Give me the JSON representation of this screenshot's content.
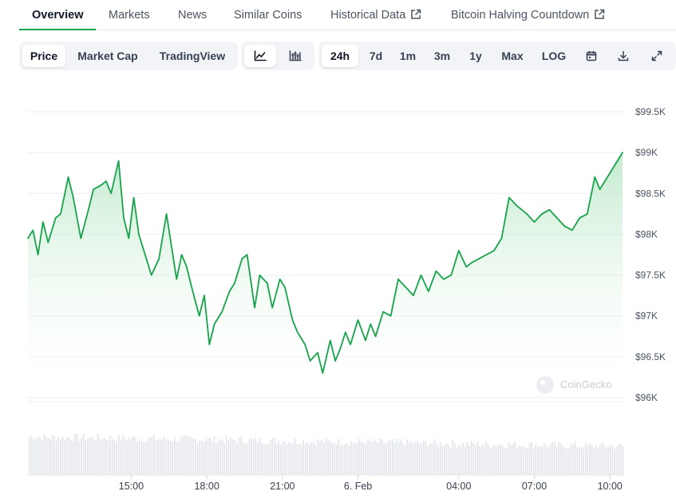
{
  "tabs": [
    {
      "label": "Overview",
      "active": true
    },
    {
      "label": "Markets"
    },
    {
      "label": "News"
    },
    {
      "label": "Similar Coins"
    },
    {
      "label": "Historical Data",
      "external": true
    },
    {
      "label": "Bitcoin Halving Countdown",
      "external": true
    }
  ],
  "toolbar": {
    "metric_buttons": [
      {
        "label": "Price",
        "active": true
      },
      {
        "label": "Market Cap"
      },
      {
        "label": "TradingView"
      }
    ],
    "chart_type_icons": [
      "line-chart-icon",
      "candlestick-icon"
    ],
    "ranges": [
      {
        "label": "24h",
        "active": true
      },
      {
        "label": "7d"
      },
      {
        "label": "1m"
      },
      {
        "label": "3m"
      },
      {
        "label": "1y"
      },
      {
        "label": "Max"
      },
      {
        "label": "LOG"
      }
    ],
    "tool_icons": [
      "calendar-icon",
      "download-icon",
      "fullscreen-icon"
    ]
  },
  "watermark": "CoinGecko",
  "colors": {
    "line": "#16a34a",
    "fill_top": "#bfe9cb",
    "volume": "#e4e7eb",
    "tab_underline": "#16a34a"
  },
  "chart_data": {
    "type": "area",
    "currency": "USD",
    "y_ticks": [
      {
        "value": 99500,
        "label": "$99.5K"
      },
      {
        "value": 99000,
        "label": "$99K"
      },
      {
        "value": 98500,
        "label": "$98.5K"
      },
      {
        "value": 98000,
        "label": "$98K"
      },
      {
        "value": 97500,
        "label": "$97.5K"
      },
      {
        "value": 97000,
        "label": "$97K"
      },
      {
        "value": 96500,
        "label": "$96.5K"
      },
      {
        "value": 96000,
        "label": "$96K"
      }
    ],
    "ylim": [
      96000,
      99500
    ],
    "x_ticks": [
      {
        "value": 15,
        "label": "15:00"
      },
      {
        "value": 18,
        "label": "18:00"
      },
      {
        "value": 21,
        "label": "21:00"
      },
      {
        "value": 24,
        "label": "6. Feb"
      },
      {
        "value": 28,
        "label": "04:00"
      },
      {
        "value": 31,
        "label": "07:00"
      },
      {
        "value": 34,
        "label": "10:00"
      }
    ],
    "xlim": [
      10.9,
      34.5
    ],
    "grid": true,
    "series": [
      {
        "x": [
          10.9,
          11.1,
          11.3,
          11.5,
          11.7,
          12.0,
          12.2,
          12.5,
          12.7,
          13.0,
          13.3,
          13.5,
          13.8,
          14.0,
          14.2,
          14.5,
          14.7,
          14.9,
          15.1,
          15.3,
          15.5,
          15.8,
          16.1,
          16.4,
          16.6,
          16.8,
          17.0,
          17.2,
          17.4,
          17.7,
          17.9,
          18.1,
          18.3,
          18.6,
          18.9,
          19.1,
          19.4,
          19.6,
          19.9,
          20.1,
          20.4,
          20.6,
          20.9,
          21.1,
          21.4,
          21.6,
          21.9,
          22.1,
          22.4,
          22.6,
          22.9,
          23.1,
          23.3,
          23.5,
          23.7,
          24.0,
          24.3,
          24.5,
          24.7,
          25.0,
          25.3,
          25.6,
          25.9,
          26.2,
          26.5,
          26.8,
          27.1,
          27.4,
          27.7,
          28.0,
          28.3,
          28.5,
          28.8,
          29.1,
          29.4,
          29.7,
          30.0,
          30.3,
          30.5,
          30.7,
          31.0,
          31.3,
          31.6,
          31.9,
          32.2,
          32.5,
          32.8,
          33.1,
          33.4,
          33.6,
          33.8,
          34.1,
          34.3,
          34.5
        ],
        "y": [
          97950,
          98050,
          97750,
          98150,
          97900,
          98200,
          98250,
          98700,
          98450,
          97950,
          98300,
          98550,
          98600,
          98650,
          98500,
          98900,
          98200,
          97950,
          98450,
          98000,
          97800,
          97500,
          97700,
          98250,
          97850,
          97450,
          97750,
          97600,
          97350,
          97000,
          97250,
          96650,
          96900,
          97050,
          97300,
          97400,
          97700,
          97750,
          97100,
          97500,
          97400,
          97100,
          97450,
          97350,
          96950,
          96800,
          96650,
          96450,
          96550,
          96300,
          96700,
          96450,
          96600,
          96800,
          96650,
          96950,
          96700,
          96900,
          96750,
          97050,
          97000,
          97450,
          97350,
          97250,
          97500,
          97300,
          97550,
          97450,
          97500,
          97800,
          97600,
          97650,
          97700,
          97750,
          97800,
          97950,
          98450,
          98350,
          98300,
          98250,
          98150,
          98250,
          98300,
          98200,
          98100,
          98050,
          98200,
          98250,
          98700,
          98550,
          98650,
          98800,
          98900,
          99000
        ]
      }
    ],
    "volume": {
      "axis": "unlabeled"
    }
  }
}
